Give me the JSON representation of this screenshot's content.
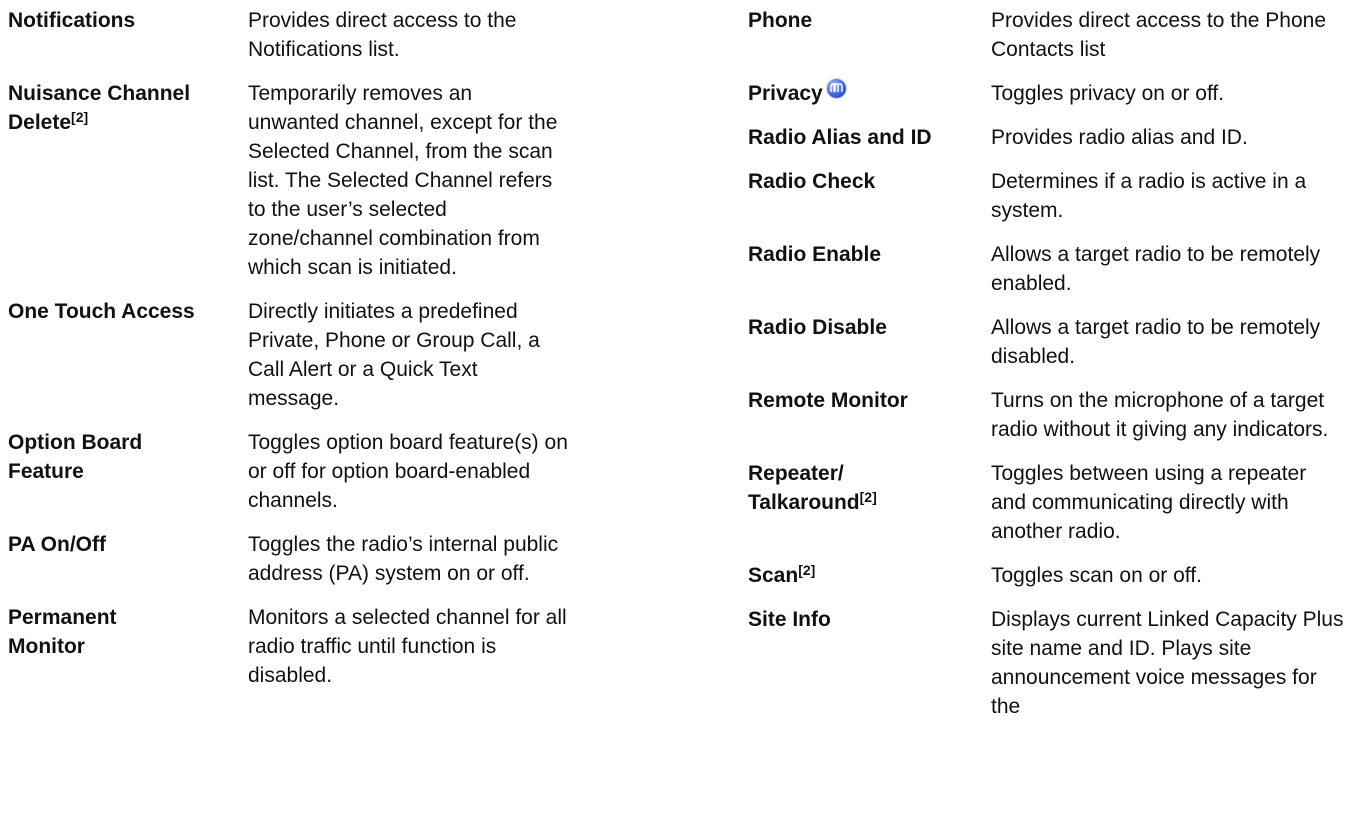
{
  "left_column": [
    {
      "term": "Notifications",
      "sup": "",
      "desc": "Provides direct access to the Notifications list."
    },
    {
      "term": "Nuisance Channel",
      "term2": "Delete",
      "sup": "[2]",
      "desc": "Temporarily removes an unwanted channel, except for the Selected Channel, from the scan list. The Selected Channel refers to the user’s selected zone/channel combination from which scan is initiated."
    },
    {
      "term": "One Touch Access",
      "sup": "",
      "desc": "Directly initiates a predefined Private, Phone or Group Call, a Call Alert or a Quick Text message."
    },
    {
      "term": "Option Board",
      "term2": "Feature",
      "sup": "",
      "desc": "Toggles option board feature(s) on or off for option board-enabled channels."
    },
    {
      "term": "PA On/Off",
      "sup": "",
      "desc": "Toggles the radio’s internal public address (PA) system on or off."
    },
    {
      "term": "Permanent",
      "term2": "Monitor",
      "sup": "",
      "desc": "Monitors a selected channel for all radio traffic until function is disabled."
    }
  ],
  "right_column": [
    {
      "term": "Phone",
      "sup": "",
      "desc": "Provides direct access to the Phone Contacts list"
    },
    {
      "term": "Privacy",
      "sup": "",
      "icon": "privacy-icon",
      "desc": "Toggles privacy on or off."
    },
    {
      "term": "Radio Alias and ID",
      "sup": "",
      "desc": "Provides radio alias and ID."
    },
    {
      "term": "Radio Check",
      "sup": "",
      "desc": "Determines if a radio is active in a system."
    },
    {
      "term": "Radio Enable",
      "sup": "",
      "desc": "Allows a target radio to be remotely enabled."
    },
    {
      "term": "Radio Disable",
      "sup": "",
      "desc": "Allows a target radio to be remotely disabled."
    },
    {
      "term": "Remote Monitor",
      "sup": "",
      "desc": "Turns on the microphone of a target radio without it giving any indicators."
    },
    {
      "term": "Repeater/",
      "term2": "Talkaround",
      "sup": "[2]",
      "desc": "Toggles between using a repeater and communicating directly with another radio."
    },
    {
      "term": "Scan",
      "sup": "[2]",
      "desc": "Toggles scan on or off."
    },
    {
      "term": "Site Info",
      "sup": "",
      "desc": "Displays current Linked Capacity Plus site name and ID. Plays site announcement voice messages for the"
    }
  ]
}
